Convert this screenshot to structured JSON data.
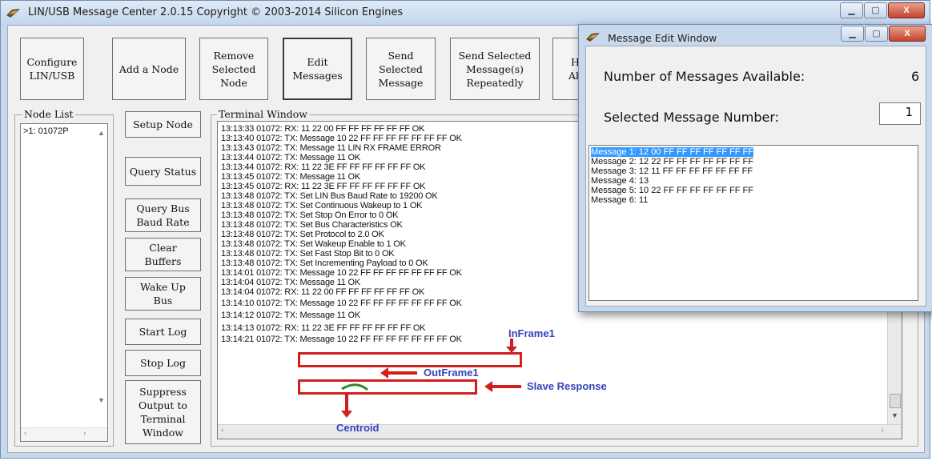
{
  "main_window": {
    "title": "LIN/USB Message Center 2.0.15    Copyright © 2003-2014 Silicon Engines",
    "caption": {
      "minimize": "▁",
      "maximize": "▢",
      "close": "X"
    }
  },
  "toolbar": [
    {
      "name": "configure-lin-usb-button",
      "label": "Configure\nLIN/USB"
    },
    {
      "name": "add-a-node-button",
      "label": "Add a Node"
    },
    {
      "name": "remove-selected-node-button",
      "label": "Remove\nSelected\nNode"
    },
    {
      "name": "edit-messages-button",
      "label": "Edit\nMessages",
      "active": true
    },
    {
      "name": "send-selected-message-button",
      "label": "Send\nSelected\nMessage"
    },
    {
      "name": "send-selected-messages-repeatedly-button",
      "label": "Send Selected\nMessage(s)\nRepeatedly"
    },
    {
      "name": "help-about-button",
      "label": "H\nAb"
    }
  ],
  "node_list": {
    "label": "Node List",
    "items": [
      ">1: 01072P"
    ]
  },
  "side_buttons": [
    {
      "name": "setup-node-button",
      "label": "Setup Node"
    },
    {
      "name": "query-status-button",
      "label": "Query Status"
    },
    {
      "name": "query-bus-baud-rate-button",
      "label": "Query Bus\nBaud Rate"
    },
    {
      "name": "clear-buffers-button",
      "label": "Clear\nBuffers"
    },
    {
      "name": "wake-up-bus-button",
      "label": "Wake Up\nBus"
    },
    {
      "name": "start-log-button",
      "label": "Start Log"
    },
    {
      "name": "stop-log-button",
      "label": "Stop Log"
    },
    {
      "name": "suppress-output-button",
      "label": "Suppress\nOutput to\nTerminal\nWindow"
    }
  ],
  "terminal": {
    "label": "Terminal Window",
    "lines": [
      "13:13:33 01072: RX: 11 22 00 FF FF FF FF FF FF OK",
      "13:13:40 01072: TX: Message 10 22 FF FF FF FF FF FF FF OK",
      "13:13:43 01072: TX: Message 11 LIN RX FRAME ERROR",
      "13:13:44 01072: TX: Message 11 OK",
      "13:13:44 01072: RX: 11 22 3E FF FF FF FF FF FF OK",
      "13:13:45 01072: TX: Message 11 OK",
      "13:13:45 01072: RX: 11 22 3E FF FF FF FF FF FF OK",
      "13:13:48 01072: TX: Set LIN Bus Baud Rate to 19200 OK",
      "13:13:48 01072: TX: Set Continuous Wakeup to 1 OK",
      "13:13:48 01072: TX: Set Stop On Error to 0 OK",
      "13:13:48 01072: TX: Set Bus Characteristics OK",
      "13:13:48 01072: TX: Set Protocol to 2.0 OK",
      "13:13:48 01072: TX: Set Wakeup Enable to 1 OK",
      "13:13:48 01072: TX: Set Fast Stop Bit to 0 OK",
      "13:13:48 01072: TX: Set Incrementing Payload to 0 OK",
      "13:14:01 01072: TX: Message 10 22 FF FF FF FF FF FF FF OK",
      "13:14:04 01072: TX: Message 11 OK",
      "13:14:04 01072: RX: 11 22 00 FF FF FF FF FF FF OK",
      "13:14:10 01072: TX: Message 10 22 FF FF FF FF FF FF FF OK",
      "13:14:12 01072: TX: Message 11 OK",
      "13:14:13 01072: RX: 11 22 3E FF FF FF FF FF FF OK",
      "13:14:21 01072: TX: Message 10 22 FF FF FF FF FF FF FF OK"
    ]
  },
  "annotations": {
    "inframe": "InFrame1",
    "outframe": "OutFrame1",
    "slave_response": "Slave Response",
    "centroid": "Centroid",
    "box_color": "#d21e1e",
    "text_color": "#3344bb"
  },
  "message_edit_window": {
    "title": "Message Edit Window",
    "available_label": "Number of Messages Available:",
    "available_value": "6",
    "selected_label": "Selected Message Number:",
    "selected_value": "1",
    "messages": [
      "Message 1: 12 00 FF FF FF FF FF FF FF",
      "Message 2: 12 22 FF FF FF FF FF FF FF",
      "Message 3: 12 11 FF FF FF FF FF FF FF",
      "Message 4: 13",
      "Message 5: 10 22 FF FF FF FF FF FF FF",
      "Message 6: 11"
    ],
    "selected_index": 0,
    "selection_color": "#3399ff"
  }
}
